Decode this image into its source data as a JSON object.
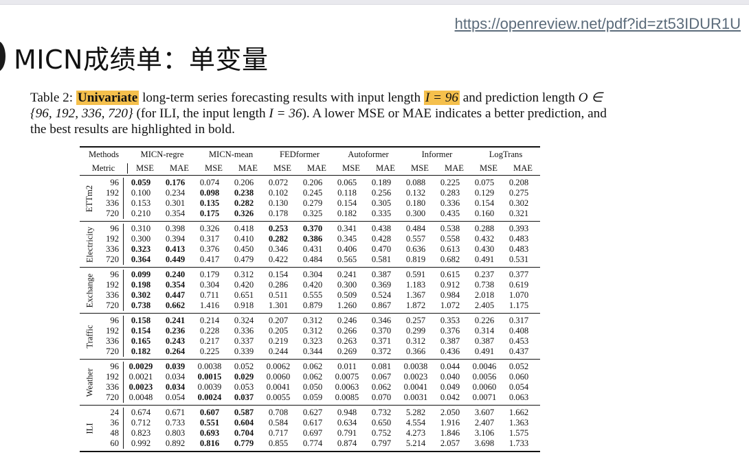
{
  "header": {
    "url": "https://openreview.net/pdf?id=zt53IDUR1U",
    "slide_title": "MICN成绩单：单变量"
  },
  "caption": {
    "prefix": "Table 2: ",
    "highlight_univariate": "Univariate",
    "mid1": " long-term series forecasting results with input length ",
    "highlight_input": "I = 96",
    "mid2": " and prediction length ",
    "O_part": "O ∈ {96, 192, 336, 720}",
    "mid3": " (for ILI, the input length ",
    "ili_part": "I = 36",
    "end": "). A lower MSE or MAE indicates a better prediction, and the best results are highlighted in bold."
  },
  "table": {
    "methods_label": "Methods",
    "metric_label": "Metric",
    "methods": [
      "MICN-regre",
      "MICN-mean",
      "FEDformer",
      "Autoformer",
      "Informer",
      "LogTrans"
    ],
    "metrics": [
      "MSE",
      "MAE"
    ],
    "datasets": [
      {
        "name": "ETTm2",
        "rows": [
          {
            "h": "96",
            "v": [
              "0.059",
              "0.176",
              "0.074",
              "0.206",
              "0.072",
              "0.206",
              "0.065",
              "0.189",
              "0.088",
              "0.225",
              "0.075",
              "0.208"
            ],
            "bold": [
              0,
              1
            ]
          },
          {
            "h": "192",
            "v": [
              "0.100",
              "0.234",
              "0.098",
              "0.238",
              "0.102",
              "0.245",
              "0.118",
              "0.256",
              "0.132",
              "0.283",
              "0.129",
              "0.275"
            ],
            "bold": [
              2,
              3
            ]
          },
          {
            "h": "336",
            "v": [
              "0.153",
              "0.301",
              "0.135",
              "0.282",
              "0.130",
              "0.279",
              "0.154",
              "0.305",
              "0.180",
              "0.336",
              "0.154",
              "0.302"
            ],
            "bold": [
              2,
              3
            ]
          },
          {
            "h": "720",
            "v": [
              "0.210",
              "0.354",
              "0.175",
              "0.326",
              "0.178",
              "0.325",
              "0.182",
              "0.335",
              "0.300",
              "0.435",
              "0.160",
              "0.321"
            ],
            "bold": [
              2,
              3
            ]
          }
        ]
      },
      {
        "name": "Electricity",
        "rows": [
          {
            "h": "96",
            "v": [
              "0.310",
              "0.398",
              "0.326",
              "0.418",
              "0.253",
              "0.370",
              "0.341",
              "0.438",
              "0.484",
              "0.538",
              "0.288",
              "0.393"
            ],
            "bold": [
              4,
              5
            ]
          },
          {
            "h": "192",
            "v": [
              "0.300",
              "0.394",
              "0.317",
              "0.410",
              "0.282",
              "0.386",
              "0.345",
              "0.428",
              "0.557",
              "0.558",
              "0.432",
              "0.483"
            ],
            "bold": [
              4,
              5
            ]
          },
          {
            "h": "336",
            "v": [
              "0.323",
              "0.413",
              "0.376",
              "0.450",
              "0.346",
              "0.431",
              "0.406",
              "0.470",
              "0.636",
              "0.613",
              "0.430",
              "0.483"
            ],
            "bold": [
              0,
              1
            ]
          },
          {
            "h": "720",
            "v": [
              "0.364",
              "0.449",
              "0.417",
              "0.479",
              "0.422",
              "0.484",
              "0.565",
              "0.581",
              "0.819",
              "0.682",
              "0.491",
              "0.531"
            ],
            "bold": [
              0,
              1
            ]
          }
        ]
      },
      {
        "name": "Exchange",
        "rows": [
          {
            "h": "96",
            "v": [
              "0.099",
              "0.240",
              "0.179",
              "0.312",
              "0.154",
              "0.304",
              "0.241",
              "0.387",
              "0.591",
              "0.615",
              "0.237",
              "0.377"
            ],
            "bold": [
              0,
              1
            ]
          },
          {
            "h": "192",
            "v": [
              "0.198",
              "0.354",
              "0.304",
              "0.420",
              "0.286",
              "0.420",
              "0.300",
              "0.369",
              "1.183",
              "0.912",
              "0.738",
              "0.619"
            ],
            "bold": [
              0,
              1
            ]
          },
          {
            "h": "336",
            "v": [
              "0.302",
              "0.447",
              "0.711",
              "0.651",
              "0.511",
              "0.555",
              "0.509",
              "0.524",
              "1.367",
              "0.984",
              "2.018",
              "1.070"
            ],
            "bold": [
              0,
              1
            ]
          },
          {
            "h": "720",
            "v": [
              "0.738",
              "0.662",
              "1.416",
              "0.918",
              "1.301",
              "0.879",
              "1.260",
              "0.867",
              "1.872",
              "1.072",
              "2.405",
              "1.175"
            ],
            "bold": [
              0,
              1
            ]
          }
        ]
      },
      {
        "name": "Traffic",
        "rows": [
          {
            "h": "96",
            "v": [
              "0.158",
              "0.241",
              "0.214",
              "0.324",
              "0.207",
              "0.312",
              "0.246",
              "0.346",
              "0.257",
              "0.353",
              "0.226",
              "0.317"
            ],
            "bold": [
              0,
              1
            ]
          },
          {
            "h": "192",
            "v": [
              "0.154",
              "0.236",
              "0.228",
              "0.336",
              "0.205",
              "0.312",
              "0.266",
              "0.370",
              "0.299",
              "0.376",
              "0.314",
              "0.408"
            ],
            "bold": [
              0,
              1
            ]
          },
          {
            "h": "336",
            "v": [
              "0.165",
              "0.243",
              "0.217",
              "0.337",
              "0.219",
              "0.323",
              "0.263",
              "0.371",
              "0.312",
              "0.387",
              "0.387",
              "0.453"
            ],
            "bold": [
              0,
              1
            ]
          },
          {
            "h": "720",
            "v": [
              "0.182",
              "0.264",
              "0.225",
              "0.339",
              "0.244",
              "0.344",
              "0.269",
              "0.372",
              "0.366",
              "0.436",
              "0.491",
              "0.437"
            ],
            "bold": [
              0,
              1
            ]
          }
        ]
      },
      {
        "name": "Weather",
        "rows": [
          {
            "h": "96",
            "v": [
              "0.0029",
              "0.039",
              "0.0038",
              "0.052",
              "0.0062",
              "0.062",
              "0.011",
              "0.081",
              "0.0038",
              "0.044",
              "0.0046",
              "0.052"
            ],
            "bold": [
              0,
              1
            ]
          },
          {
            "h": "192",
            "v": [
              "0.0021",
              "0.034",
              "0.0015",
              "0.029",
              "0.0060",
              "0.062",
              "0.0075",
              "0.067",
              "0.0023",
              "0.040",
              "0.0056",
              "0.060"
            ],
            "bold": [
              2,
              3
            ]
          },
          {
            "h": "336",
            "v": [
              "0.0023",
              "0.034",
              "0.0039",
              "0.053",
              "0.0041",
              "0.050",
              "0.0063",
              "0.062",
              "0.0041",
              "0.049",
              "0.0060",
              "0.054"
            ],
            "bold": [
              0,
              1
            ]
          },
          {
            "h": "720",
            "v": [
              "0.0048",
              "0.054",
              "0.0024",
              "0.037",
              "0.0055",
              "0.059",
              "0.0085",
              "0.070",
              "0.0031",
              "0.042",
              "0.0071",
              "0.063"
            ],
            "bold": [
              2,
              3
            ]
          }
        ]
      },
      {
        "name": "ILI",
        "rows": [
          {
            "h": "24",
            "v": [
              "0.674",
              "0.671",
              "0.607",
              "0.587",
              "0.708",
              "0.627",
              "0.948",
              "0.732",
              "5.282",
              "2.050",
              "3.607",
              "1.662"
            ],
            "bold": [
              2,
              3
            ]
          },
          {
            "h": "36",
            "v": [
              "0.712",
              "0.733",
              "0.551",
              "0.604",
              "0.584",
              "0.617",
              "0.634",
              "0.650",
              "4.554",
              "1.916",
              "2.407",
              "1.363"
            ],
            "bold": [
              2,
              3
            ]
          },
          {
            "h": "48",
            "v": [
              "0.823",
              "0.803",
              "0.693",
              "0.704",
              "0.717",
              "0.697",
              "0.791",
              "0.752",
              "4.273",
              "1.846",
              "3.106",
              "1.575"
            ],
            "bold": [
              2,
              3
            ]
          },
          {
            "h": "60",
            "v": [
              "0.992",
              "0.892",
              "0.816",
              "0.779",
              "0.855",
              "0.774",
              "0.874",
              "0.797",
              "5.214",
              "2.057",
              "3.698",
              "1.733"
            ],
            "bold": [
              2,
              3
            ]
          }
        ]
      }
    ]
  }
}
